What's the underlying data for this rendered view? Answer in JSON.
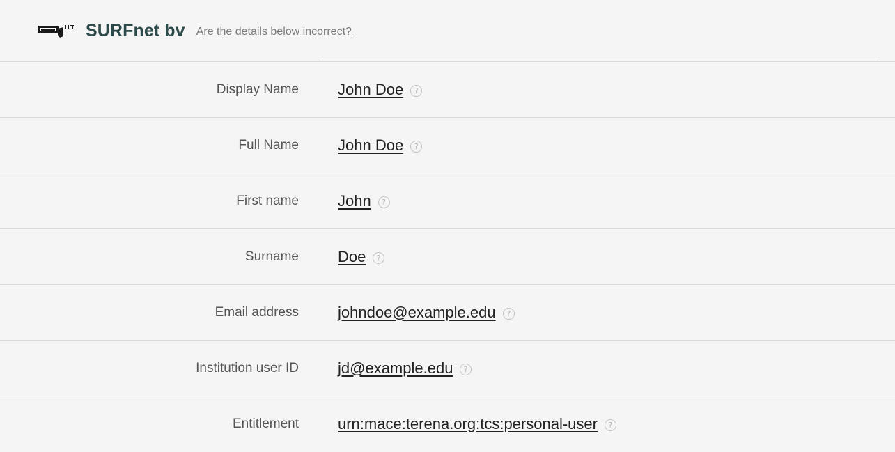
{
  "header": {
    "org_name": "SURFnet bv",
    "incorrect_link": "Are the details below incorrect?",
    "logo_icon": "surfnet-logo"
  },
  "rows": [
    {
      "label": "Display Name",
      "value": "John Doe",
      "help_icon": "question-circle-icon",
      "help_glyph": "?"
    },
    {
      "label": "Full Name",
      "value": "John Doe",
      "help_icon": "question-circle-icon",
      "help_glyph": "?"
    },
    {
      "label": "First name",
      "value": "John",
      "help_icon": "question-circle-icon",
      "help_glyph": "?"
    },
    {
      "label": "Surname",
      "value": "Doe",
      "help_icon": "question-circle-icon",
      "help_glyph": "?"
    },
    {
      "label": "Email address",
      "value": "johndoe@example.edu",
      "help_icon": "question-circle-icon",
      "help_glyph": "?"
    },
    {
      "label": "Institution user ID",
      "value": "jd@example.edu",
      "help_icon": "question-circle-icon",
      "help_glyph": "?"
    },
    {
      "label": "Entitlement",
      "value": "urn:mace:terena.org:tcs:personal-user",
      "help_icon": "question-circle-icon",
      "help_glyph": "?"
    }
  ],
  "colors": {
    "background": "#f5f5f5",
    "org_name": "#2c4a4a",
    "divider": "#dcdcdc"
  }
}
